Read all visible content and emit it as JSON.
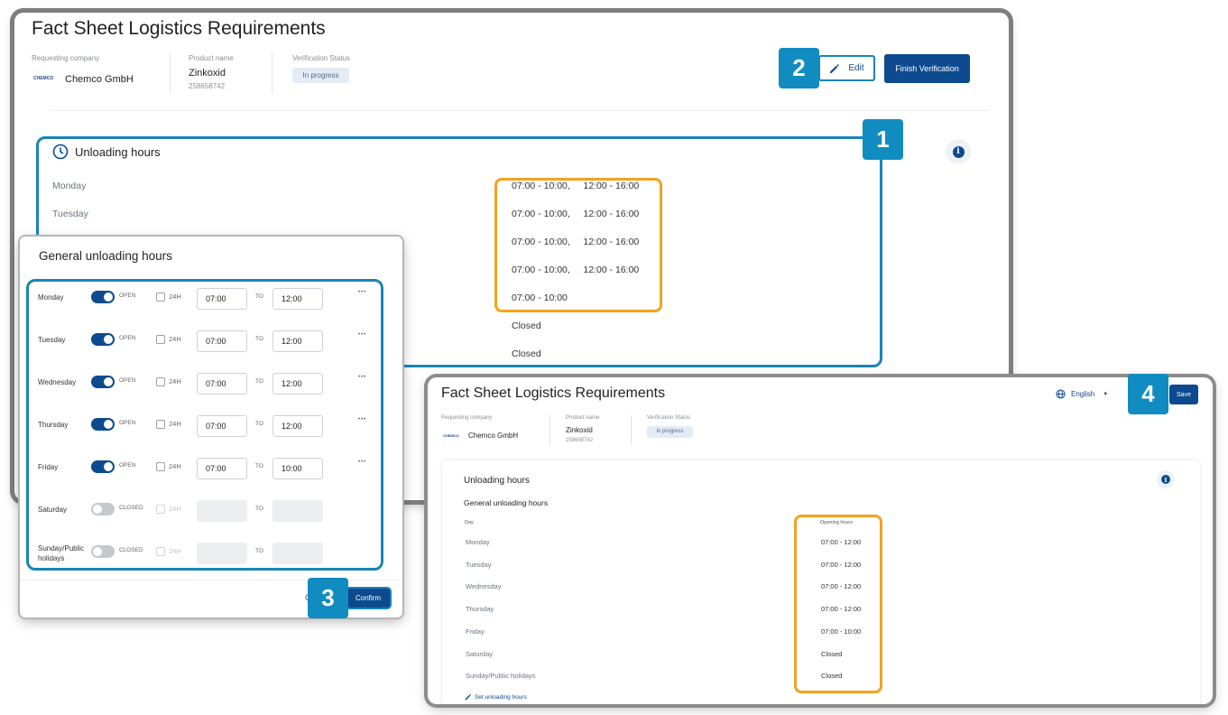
{
  "main_window": {
    "title": "Fact Sheet Logistics Requirements",
    "requesting_company_label": "Requesting company",
    "company_logo_text": "CHEMCO",
    "company_name": "Chemco GmbH",
    "product_name_label": "Product name",
    "product_name": "Zinkoxid",
    "product_id": "258658742",
    "verification_status_label": "Verification Status",
    "verification_status": "In progress",
    "edit_label": "Edit",
    "finish_label": "Finish Verification",
    "section_title": "Unloading hours",
    "days": [
      {
        "day": "Monday",
        "hours": "07:00 - 10:00,     12:00 - 16:00"
      },
      {
        "day": "Tuesday",
        "hours": "07:00 - 10:00,     12:00 - 16:00"
      },
      {
        "day": "",
        "hours": "07:00 - 10:00,     12:00 - 16:00"
      },
      {
        "day": "",
        "hours": "07:00 - 10:00,     12:00 - 16:00"
      },
      {
        "day": "",
        "hours": "07:00 - 10:00"
      },
      {
        "day": "",
        "hours": "Closed"
      },
      {
        "day": "",
        "hours": "Closed"
      }
    ]
  },
  "dialog": {
    "title": "General unloading hours",
    "to_label": "TO",
    "h24_label": "24H",
    "rows": [
      {
        "day": "Monday",
        "state": "OPEN",
        "on": true,
        "from": "07:00",
        "to": "12:00"
      },
      {
        "day": "Tuesday",
        "state": "OPEN",
        "on": true,
        "from": "07:00",
        "to": "12:00"
      },
      {
        "day": "Wednesday",
        "state": "OPEN",
        "on": true,
        "from": "07:00",
        "to": "12:00"
      },
      {
        "day": "Thursday",
        "state": "OPEN",
        "on": true,
        "from": "07:00",
        "to": "12:00"
      },
      {
        "day": "Friday",
        "state": "OPEN",
        "on": true,
        "from": "07:00",
        "to": "10:00"
      },
      {
        "day": "Saturday",
        "state": "CLOSED",
        "on": false,
        "from": "",
        "to": ""
      },
      {
        "day": "Sunday/Public holidays",
        "state": "CLOSED",
        "on": false,
        "from": "",
        "to": ""
      }
    ],
    "cancel_partial": "C",
    "confirm_label": "Confirm"
  },
  "summary_window": {
    "title": "Fact Sheet Logistics Requirements",
    "language": "English",
    "save_label": "Save",
    "requesting_company_label": "Requesting company",
    "company_name": "Chemco GmbH",
    "product_name_label": "Product name",
    "product_name": "Zinkoxid",
    "product_id": "258658742",
    "verification_status_label": "Verification Status",
    "verification_status": "In progress",
    "section_title": "Unloading hours",
    "subsection_title": "General unloading hours",
    "col_day": "Day",
    "col_hours": "Opening hours",
    "rows": [
      {
        "day": "Monday",
        "hours": "07:00 - 12:00"
      },
      {
        "day": "Tuesday",
        "hours": "07:00 - 12:00"
      },
      {
        "day": "Wednesday",
        "hours": "07:00 - 12:00"
      },
      {
        "day": "Thursday",
        "hours": "07:00 - 12:00"
      },
      {
        "day": "Friday",
        "hours": "07:00 - 10:00"
      },
      {
        "day": "Saturday",
        "hours": "Closed"
      },
      {
        "day": "Sunday/Public holidays",
        "hours": "Closed"
      }
    ],
    "set_link": "Set unloading hours"
  },
  "callouts": [
    "1",
    "2",
    "3",
    "4"
  ],
  "colors": {
    "primary": "#0d4a8f",
    "callout": "#118cc0",
    "highlight": "#f3a21f",
    "frame": "#1985b7"
  }
}
